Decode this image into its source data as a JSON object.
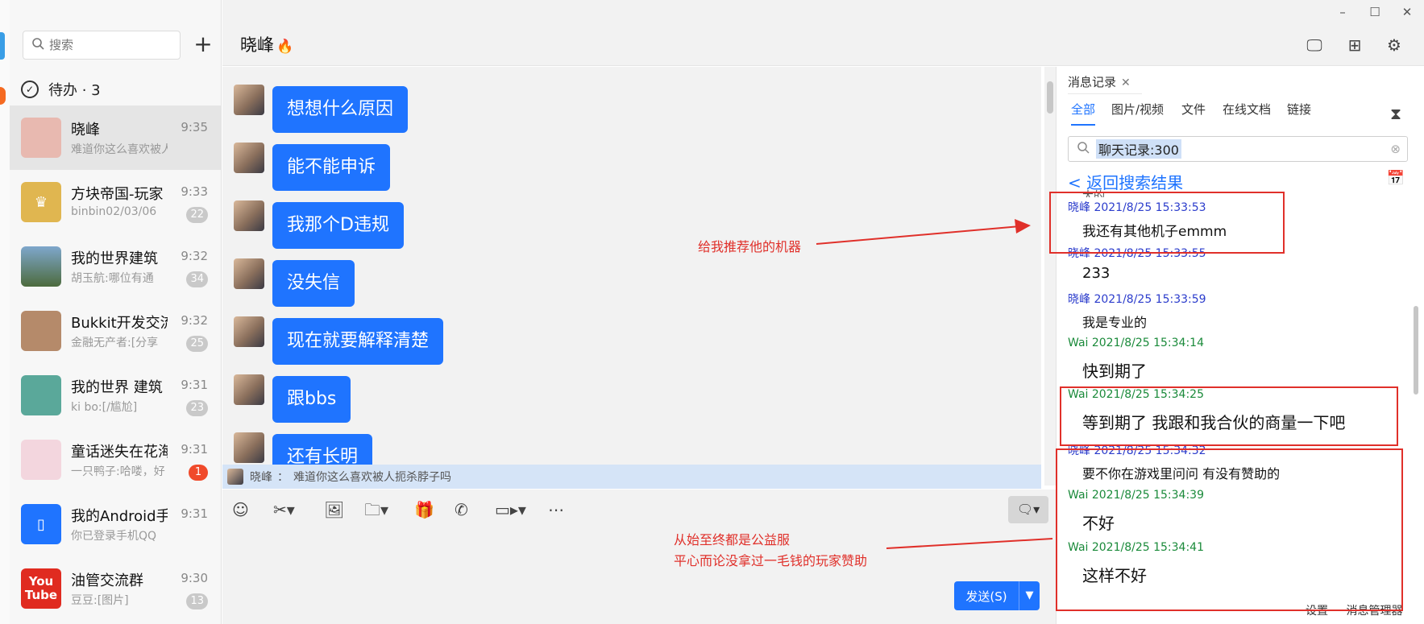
{
  "search": {
    "placeholder": "搜索"
  },
  "add_icon": "plus-icon",
  "todo": {
    "label": "待办 · 3"
  },
  "conversations": [
    {
      "name": "晓峰",
      "time": "9:35",
      "preview": "难道你这么喜欢被人扼",
      "badge": "",
      "avatar_color": "#e8b9b0"
    },
    {
      "name": "方块帝国-玩家",
      "time": "9:33",
      "preview": "binbin02/03/06",
      "badge": "22",
      "avatar_color": "#e0b650"
    },
    {
      "name": "我的世界建筑",
      "time": "9:32",
      "preview": "胡玉航:哪位有通",
      "badge": "34",
      "avatar_color": "#6f8aa8"
    },
    {
      "name": "Bukkit开发交流",
      "time": "9:32",
      "preview": "金融无产者:[分享",
      "badge": "25",
      "avatar_color": "#b58a6a"
    },
    {
      "name": "我的世界 建筑",
      "time": "9:31",
      "preview": "ki bo:[/尴尬]",
      "badge": "23",
      "avatar_color": "#5aa89a"
    },
    {
      "name": "童话迷失在花海",
      "time": "9:31",
      "preview": "一只鸭子:哈喽，好",
      "badge": "1",
      "avatar_color": "#f3d6de"
    },
    {
      "name": "我的Android手机",
      "time": "9:31",
      "preview": "你已登录手机QQ",
      "badge": "",
      "avatar_color": "#1f74ff"
    },
    {
      "name": "油管交流群",
      "time": "9:30",
      "preview": "豆豆:[图片]",
      "badge": "13",
      "avatar_color": "#e02b20"
    }
  ],
  "chat": {
    "title": "晓峰",
    "messages": [
      "想想什么原因",
      "能不能申诉",
      "我那个D违规",
      "没失信",
      "现在就要解释清楚",
      "跟bbs",
      "还有长明"
    ],
    "quote_sender": "晓峰",
    "quote_sep": "：",
    "quote_text": "难道你这么喜欢被人扼杀脖子吗"
  },
  "toolbar_icons": [
    "emoji-icon",
    "scissors-icon",
    "image-icon",
    "folder-icon",
    "gift-icon",
    "phone-icon",
    "video-icon",
    "more-icon"
  ],
  "send": {
    "label": "发送(S)"
  },
  "annotations": {
    "a1": "给我推荐他的机器",
    "a2_line1": "从始至终都是公益服",
    "a2_line2": "平心而论没拿过一毛钱的玩家赞助"
  },
  "history": {
    "tab_label": "消息记录",
    "filters": [
      "全部",
      "图片/视频",
      "文件",
      "在线文档",
      "链接"
    ],
    "search_value": "聊天记录:300",
    "back_label": "< 返回搜索结果",
    "cut_text": "大的",
    "entries": [
      {
        "meta": "晓峰 2021/8/25 15:33:53",
        "text": "我还有其他机子emmm",
        "color": "blue"
      },
      {
        "meta": "晓峰 2021/8/25 15:33:55",
        "text": "233",
        "color": "blue"
      },
      {
        "meta": "晓峰 2021/8/25 15:33:59",
        "text": "我是专业的",
        "color": "blue"
      },
      {
        "meta": "Wai 2021/8/25 15:34:14",
        "text": "快到期了",
        "color": "green"
      },
      {
        "meta": "Wai 2021/8/25 15:34:25",
        "text": "等到期了 我跟和我合伙的商量一下吧",
        "color": "green"
      },
      {
        "meta": "晓峰 2021/8/25 15:34:32",
        "text": "要不你在游戏里问问  有没有赞助的",
        "color": "blue"
      },
      {
        "meta": "Wai 2021/8/25 15:34:39",
        "text": "不好",
        "color": "green"
      },
      {
        "meta": "Wai 2021/8/25 15:34:41",
        "text": "这样不好",
        "color": "green"
      }
    ],
    "footer": [
      "设置",
      "消息管理器"
    ]
  }
}
